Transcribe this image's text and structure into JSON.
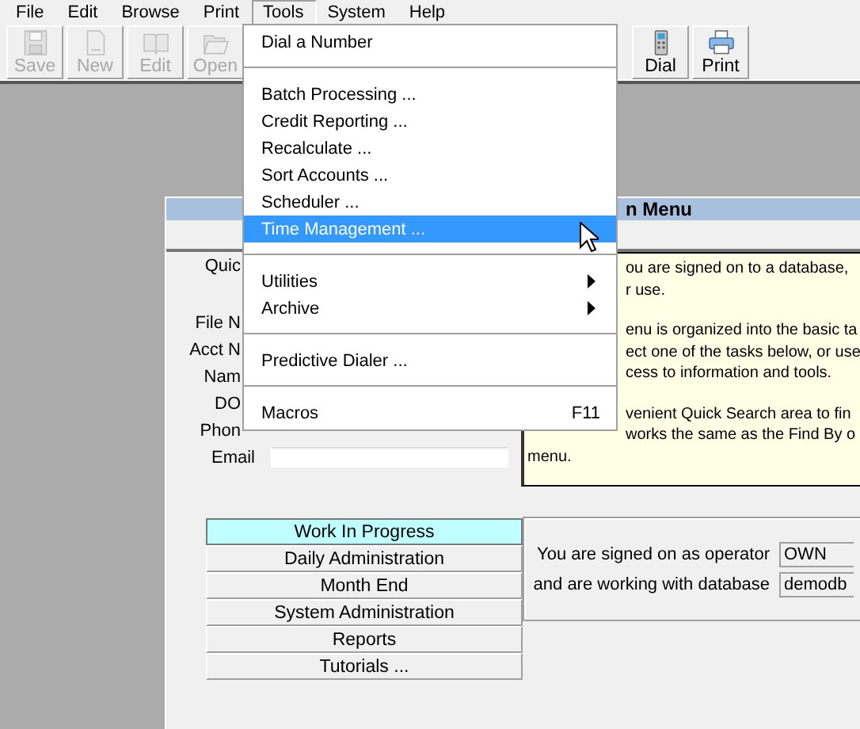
{
  "menu_bar": [
    {
      "label": "File",
      "selected": false
    },
    {
      "label": "Edit",
      "selected": false
    },
    {
      "label": "Browse",
      "selected": false
    },
    {
      "label": "Print",
      "selected": false
    },
    {
      "label": "Tools",
      "selected": true
    },
    {
      "label": "System",
      "selected": false
    },
    {
      "label": "Help",
      "selected": false
    }
  ],
  "toolbar": [
    {
      "label": "Save",
      "kind": "floppy",
      "disabled": true
    },
    {
      "label": "New",
      "kind": "page",
      "disabled": true
    },
    {
      "label": "Edit",
      "kind": "book",
      "disabled": true
    },
    {
      "label": "Open",
      "kind": "folder",
      "disabled": true
    },
    {
      "label": "Dial",
      "kind": "phone",
      "disabled": false
    },
    {
      "label": "Print",
      "kind": "printer",
      "disabled": false
    }
  ],
  "tools_menu": [
    {
      "kind": "item",
      "label": "Dial a Number",
      "selected": false,
      "submenu": false
    },
    {
      "kind": "separator"
    },
    {
      "kind": "item",
      "label": "Batch Processing ...",
      "selected": false,
      "submenu": false
    },
    {
      "kind": "item",
      "label": "Credit Reporting ...",
      "selected": false,
      "submenu": false
    },
    {
      "kind": "item",
      "label": "Recalculate ...",
      "selected": false,
      "submenu": false
    },
    {
      "kind": "item",
      "label": "Sort Accounts ...",
      "selected": false,
      "submenu": false
    },
    {
      "kind": "item",
      "label": "Scheduler ...",
      "selected": false,
      "submenu": false
    },
    {
      "kind": "item",
      "label": "Time Management ...",
      "selected": true,
      "submenu": false
    },
    {
      "kind": "separator"
    },
    {
      "kind": "item",
      "label": "Utilities",
      "selected": false,
      "submenu": true
    },
    {
      "kind": "item",
      "label": "Archive",
      "selected": false,
      "submenu": true
    },
    {
      "kind": "separator"
    },
    {
      "kind": "item",
      "label": "Predictive Dialer ...",
      "selected": false,
      "submenu": false
    },
    {
      "kind": "separator"
    },
    {
      "kind": "item",
      "label": "Macros",
      "selected": false,
      "submenu": false,
      "shortcut": "F11"
    }
  ],
  "window": {
    "title": "n Menu",
    "form_labels": [
      {
        "label": "Quic",
        "field": false
      },
      {
        "label": "File N",
        "field": false
      },
      {
        "label": "Acct N",
        "field": false
      },
      {
        "label": "Nam",
        "field": false
      },
      {
        "label": "DO",
        "field": false
      },
      {
        "label": "Phon",
        "field": false
      },
      {
        "label": "Email",
        "field": true
      }
    ],
    "info_paragraphs": [
      [
        {
          "kind": "cut",
          "text": "ou are signed on to a database,"
        },
        {
          "kind": "cut",
          "text": "r use."
        }
      ],
      [
        {
          "kind": "cut",
          "text": "enu is organized into the basic ta"
        },
        {
          "kind": "cut",
          "text": "ect one of the tasks below, or use"
        },
        {
          "kind": "cut",
          "text": "cess to information and tools."
        }
      ],
      [
        {
          "kind": "cut",
          "text": "venient Quick Search area to fin"
        },
        {
          "kind": "cut",
          "text": "works the same as the Find By o"
        },
        {
          "kind": "whole",
          "text": "menu."
        }
      ]
    ],
    "tasks": [
      {
        "label": "Work In Progress",
        "selected": true
      },
      {
        "label": "Daily Administration",
        "selected": false
      },
      {
        "label": "Month End",
        "selected": false
      },
      {
        "label": "System Administration",
        "selected": false
      },
      {
        "label": "Reports",
        "selected": false
      },
      {
        "label": "Tutorials ...",
        "selected": false
      }
    ],
    "signon": [
      {
        "label": "You are signed on as operator",
        "value": "OWN"
      },
      {
        "label": "and are working with database",
        "value": "demodb"
      }
    ]
  }
}
